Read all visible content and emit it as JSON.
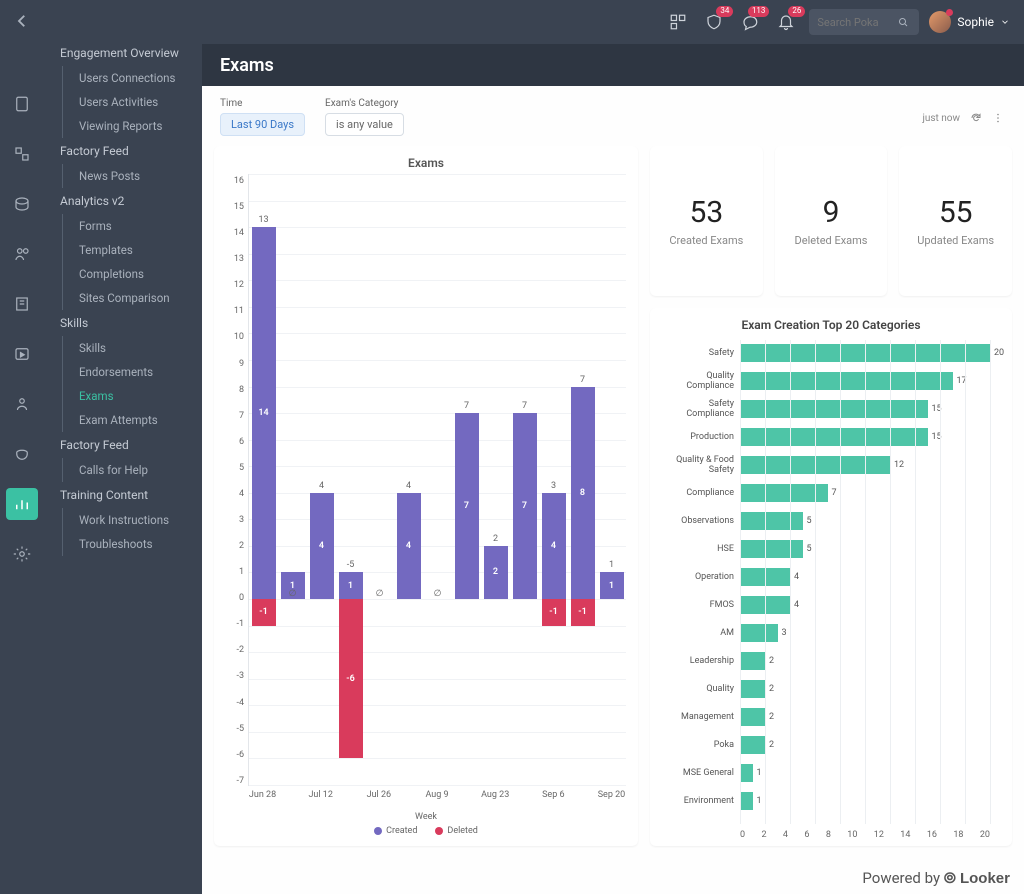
{
  "header": {
    "title": "Exams",
    "search_placeholder": "Search Poka",
    "user_name": "Sophie",
    "badges": {
      "b1": "34",
      "b2": "113",
      "b3": "26"
    }
  },
  "sidebar": {
    "groups": [
      {
        "label": "Engagement Overview",
        "items": [
          "Users Connections",
          "Users Activities",
          "Viewing Reports"
        ]
      },
      {
        "label": "Factory Feed",
        "items": [
          "News Posts"
        ]
      },
      {
        "label": "Analytics v2",
        "items": [
          "Forms"
        ]
      },
      {
        "label": "",
        "items": [
          "Templates",
          "Completions",
          "Sites Comparison"
        ]
      },
      {
        "label": "Skills",
        "items": [
          "Skills",
          "Endorsements",
          "Exams",
          "Exam Attempts"
        ]
      },
      {
        "label": "Factory Feed",
        "items": [
          "Calls for Help"
        ]
      },
      {
        "label": "Training Content",
        "items": [
          "Work Instructions",
          "Troubleshoots"
        ]
      }
    ],
    "selected": "Exams"
  },
  "filters": {
    "time_label": "Time",
    "time_value": "Last 90 Days",
    "cat_label": "Exam's Category",
    "cat_value": "is any value",
    "refresh": "just now"
  },
  "stats": [
    {
      "value": "53",
      "label": "Created Exams"
    },
    {
      "value": "9",
      "label": "Deleted Exams"
    },
    {
      "value": "55",
      "label": "Updated Exams"
    }
  ],
  "chart_data": [
    {
      "type": "bar",
      "title": "Exams",
      "xlabel": "Week",
      "ylim": [
        -7,
        16
      ],
      "categories": [
        "Jun 28",
        "",
        "Jul 12",
        "",
        "Jul 26",
        "",
        "Aug 9",
        "",
        "Aug 23",
        "",
        "Sep 6",
        "",
        "Sep 20"
      ],
      "series": [
        {
          "name": "Created",
          "values": [
            14,
            1,
            4,
            1,
            0,
            4,
            0,
            7,
            2,
            7,
            4,
            8,
            1
          ],
          "color": "#7369c0",
          "labels": [
            "14",
            "1",
            "4",
            "1",
            "",
            "4",
            "",
            "7",
            "2",
            "7",
            "4",
            "8",
            "1"
          ]
        },
        {
          "name": "Deleted",
          "values": [
            -1,
            0,
            0,
            -6,
            0,
            0,
            0,
            0,
            0,
            0,
            -1,
            -1,
            0
          ],
          "color": "#d93b5c",
          "labels": [
            "-1",
            "",
            "",
            "-6",
            "",
            "",
            "",
            "",
            "",
            "",
            "-1",
            "-1",
            ""
          ]
        }
      ],
      "totals": [
        "13",
        "",
        "4",
        "-5",
        "∅",
        "4",
        "∅",
        "7",
        "2",
        "7",
        "3",
        "7",
        "1"
      ],
      "zero_marks": [
        "",
        "∅",
        "",
        "",
        "",
        "",
        "",
        "",
        "",
        "",
        "",
        "",
        ""
      ]
    },
    {
      "type": "bar",
      "orientation": "horizontal",
      "title": "Exam Creation Top 20 Categories",
      "xlim": [
        0,
        20
      ],
      "categories": [
        "Safety",
        "Quality Compliance",
        "Safety Compliance",
        "Production",
        "Quality & Food Safety",
        "Compliance",
        "Observations",
        "HSE",
        "Operation",
        "FMOS",
        "AM",
        "Leadership",
        "Quality",
        "Management",
        "Poka",
        "MSE General",
        "Environment"
      ],
      "values": [
        20,
        17,
        15,
        15,
        12,
        7,
        5,
        5,
        4,
        4,
        3,
        2,
        2,
        2,
        2,
        1,
        1
      ],
      "color": "#4ec5a7",
      "xticks": [
        0,
        2,
        4,
        6,
        8,
        10,
        12,
        14,
        16,
        18,
        20
      ]
    }
  ],
  "legend": {
    "created": "Created",
    "deleted": "Deleted"
  },
  "footer": "Powered by"
}
